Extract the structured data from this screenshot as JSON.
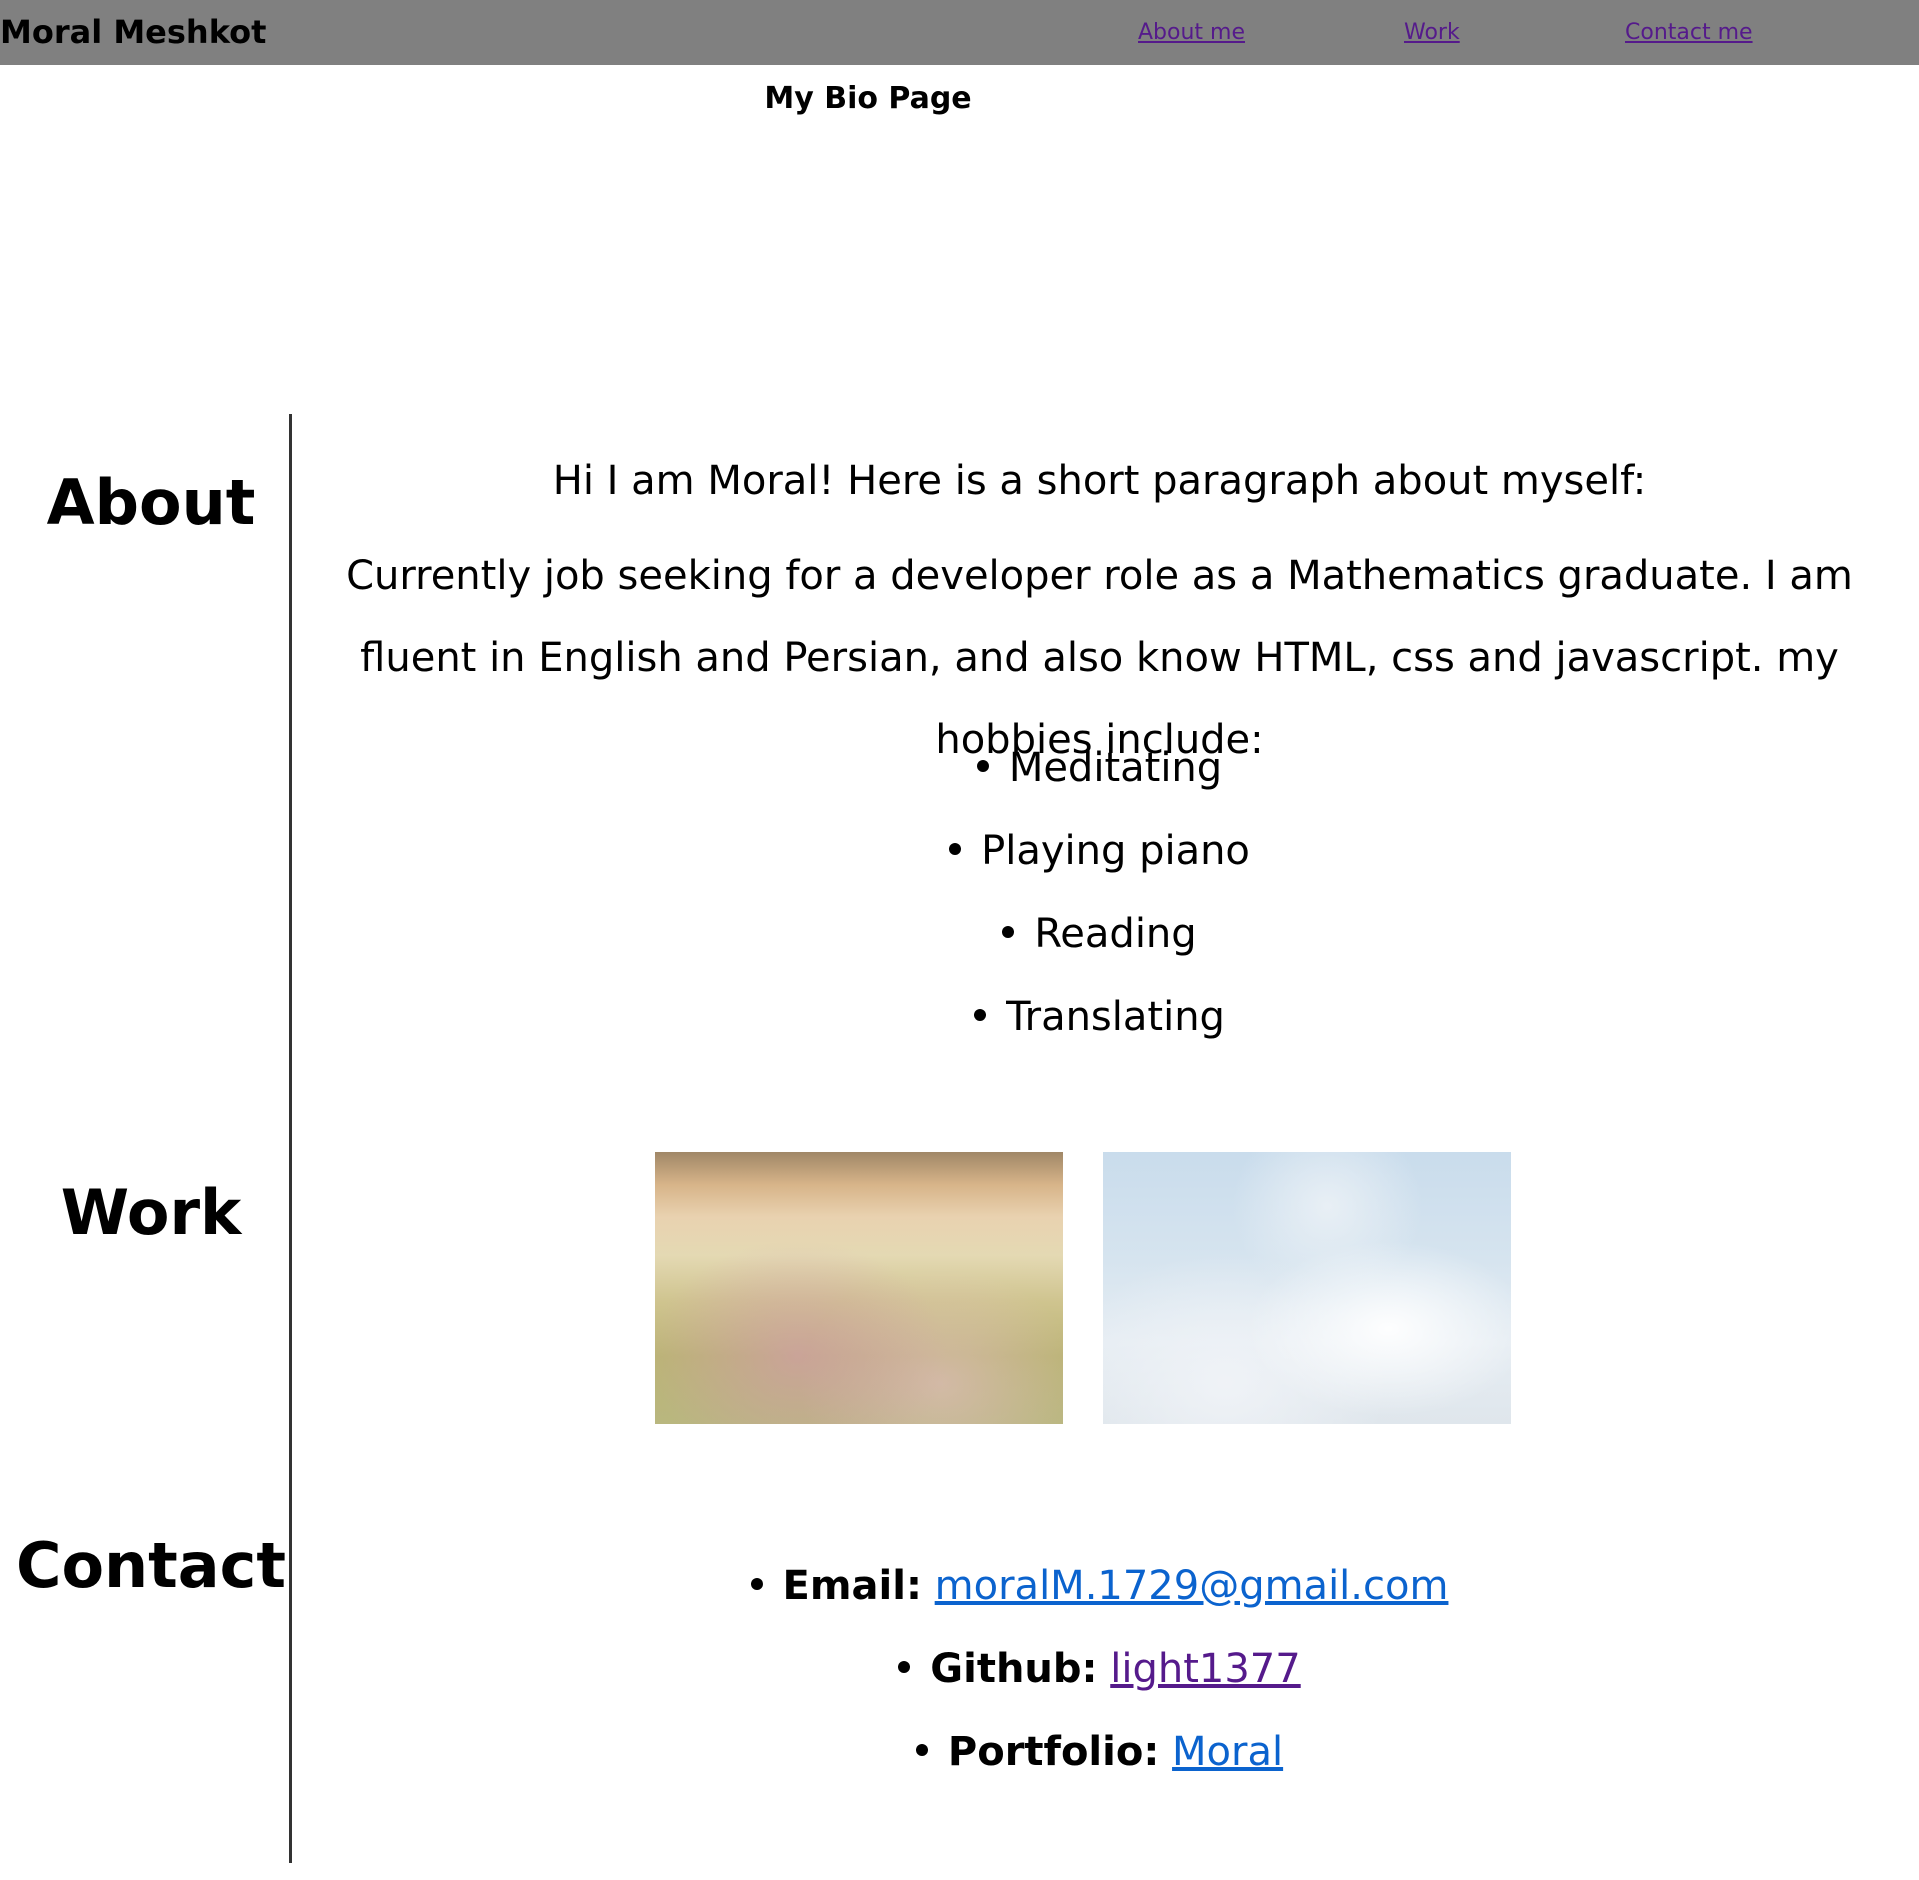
{
  "navbar": {
    "brand": "Moral Meshkot",
    "links": [
      "About me",
      "Work",
      "Contact me"
    ],
    "background_color": "#808080",
    "link_color": "#551a8b"
  },
  "page_title": "My Bio Page",
  "sections": {
    "about": {
      "heading": "About",
      "intro": "Hi I am Moral! Here is a short paragraph about myself:",
      "bio": "Currently job seeking for a developer role as a Mathematics graduate. I am fluent in English and Persian, and also know HTML, css and javascript. my hobbies include:",
      "hobbies": [
        "Meditating",
        "Playing piano",
        "Reading",
        "Translating"
      ]
    },
    "work": {
      "heading": "Work",
      "images": [
        "flower-field-photo",
        "clouds-sky-photo"
      ]
    },
    "contact": {
      "heading": "Contact",
      "items": [
        {
          "label": "Email:",
          "value": "moralM.1729@gmail.com",
          "color": "#0b63ce"
        },
        {
          "label": "Github:",
          "value": "light1377",
          "color": "#551a8b"
        },
        {
          "label": "Portfolio:",
          "value": "Moral",
          "color": "#0b63ce"
        }
      ]
    }
  }
}
